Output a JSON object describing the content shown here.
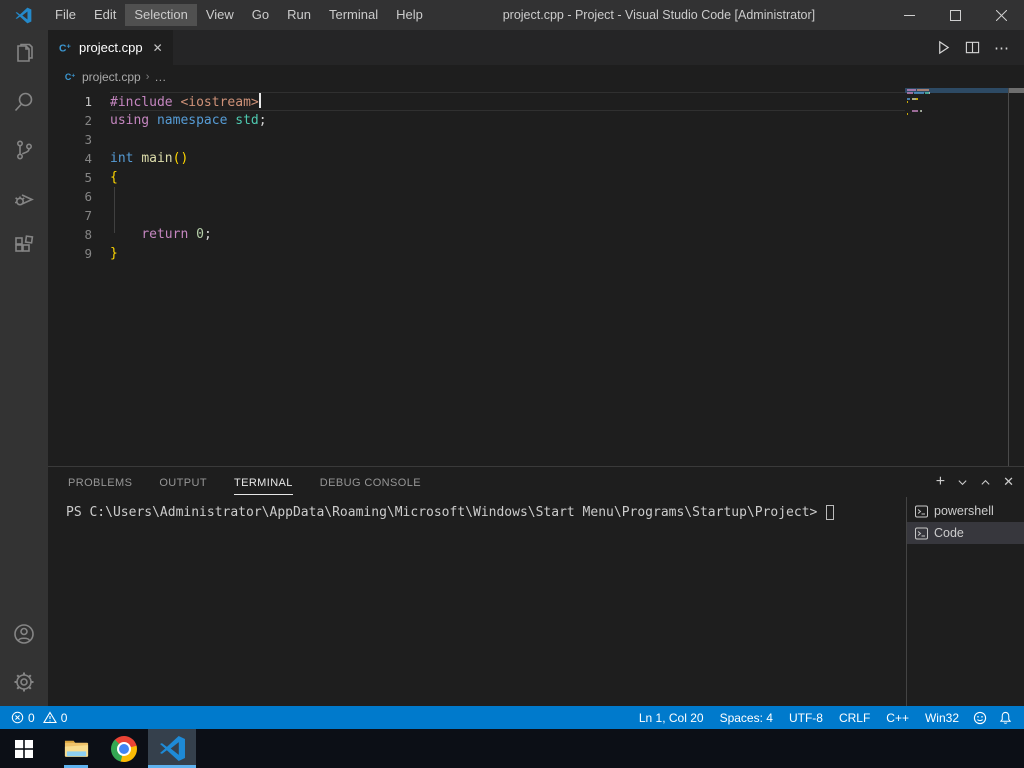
{
  "colors": {
    "accent": "#007acc",
    "kw": "#569cd6",
    "kw2": "#c586c0",
    "str": "#ce9178",
    "type": "#4ec9b0",
    "fn": "#dcdcaa",
    "num": "#b5cea8",
    "fg": "#d4d4d4",
    "bracket": "#ffd700"
  },
  "titlebar": {
    "title": "project.cpp - Project - Visual Studio Code [Administrator]",
    "menus": [
      {
        "label": "File"
      },
      {
        "label": "Edit"
      },
      {
        "label": "Selection",
        "active": true
      },
      {
        "label": "View"
      },
      {
        "label": "Go"
      },
      {
        "label": "Run"
      },
      {
        "label": "Terminal"
      },
      {
        "label": "Help"
      }
    ],
    "controls": {
      "minimize": "minimize",
      "maximize": "maximize",
      "close": "close"
    }
  },
  "activity_bar": {
    "items": [
      "explorer",
      "search",
      "source-control",
      "run-and-debug",
      "extensions"
    ],
    "bottom_items": [
      "accounts",
      "settings"
    ]
  },
  "editor_tabs": {
    "active_tab": {
      "label": "project.cpp",
      "icon": "cpp-file-icon",
      "close": "✕"
    },
    "actions": {
      "run": "run-button",
      "split": "split-editor",
      "more": "⋯"
    }
  },
  "breadcrumb": {
    "file": "project.cpp",
    "sep": "›",
    "more": "…"
  },
  "editor": {
    "cursor_position": {
      "line": 1,
      "col": 20
    },
    "lines": [
      {
        "num": "1",
        "current": true,
        "cursor": true,
        "tokens": [
          {
            "t": "#include",
            "c": "kw2"
          },
          {
            "t": " ",
            "c": "fg"
          },
          {
            "t": "<iostream>",
            "c": "str"
          }
        ]
      },
      {
        "num": "2",
        "tokens": [
          {
            "t": "using",
            "c": "kw2"
          },
          {
            "t": " ",
            "c": "fg"
          },
          {
            "t": "namespace",
            "c": "kw"
          },
          {
            "t": " ",
            "c": "fg"
          },
          {
            "t": "std",
            "c": "type"
          },
          {
            "t": ";",
            "c": "fg"
          }
        ]
      },
      {
        "num": "3",
        "tokens": []
      },
      {
        "num": "4",
        "tokens": [
          {
            "t": "int",
            "c": "kw"
          },
          {
            "t": " ",
            "c": "fg"
          },
          {
            "t": "main",
            "c": "fn"
          },
          {
            "t": "()",
            "c": "bracket"
          }
        ]
      },
      {
        "num": "5",
        "tokens": [
          {
            "t": "{",
            "c": "bracket"
          }
        ]
      },
      {
        "num": "6",
        "tokens": []
      },
      {
        "num": "7",
        "tokens": []
      },
      {
        "num": "8",
        "tokens": [
          {
            "t": "    ",
            "c": "fg"
          },
          {
            "t": "return",
            "c": "kw2"
          },
          {
            "t": " ",
            "c": "fg"
          },
          {
            "t": "0",
            "c": "num"
          },
          {
            "t": ";",
            "c": "fg"
          }
        ]
      },
      {
        "num": "9",
        "tokens": [
          {
            "t": "}",
            "c": "bracket"
          }
        ]
      }
    ]
  },
  "panel": {
    "tabs": [
      {
        "label": "PROBLEMS"
      },
      {
        "label": "OUTPUT"
      },
      {
        "label": "TERMINAL",
        "active": true
      },
      {
        "label": "DEBUG CONSOLE"
      }
    ],
    "actions": [
      "new-terminal",
      "terminal-dropdown",
      "maximize-panel",
      "close-panel"
    ],
    "terminal": {
      "prompt": "PS C:\\Users\\Administrator\\AppData\\Roaming\\Microsoft\\Windows\\Start Menu\\Programs\\Startup\\Project> "
    },
    "terminal_list": [
      {
        "label": "powershell"
      },
      {
        "label": "Code",
        "selected": true
      }
    ]
  },
  "status_bar": {
    "errors": "0",
    "warnings": "0",
    "right_items": [
      "Ln 1, Col 20",
      "Spaces: 4",
      "UTF-8",
      "CRLF",
      "C++",
      "Win32"
    ],
    "right_icons": [
      "feedback",
      "notifications"
    ]
  },
  "taskbar": {
    "items": [
      "start",
      "file-explorer",
      "chrome",
      "vscode"
    ],
    "active_item": "vscode"
  }
}
